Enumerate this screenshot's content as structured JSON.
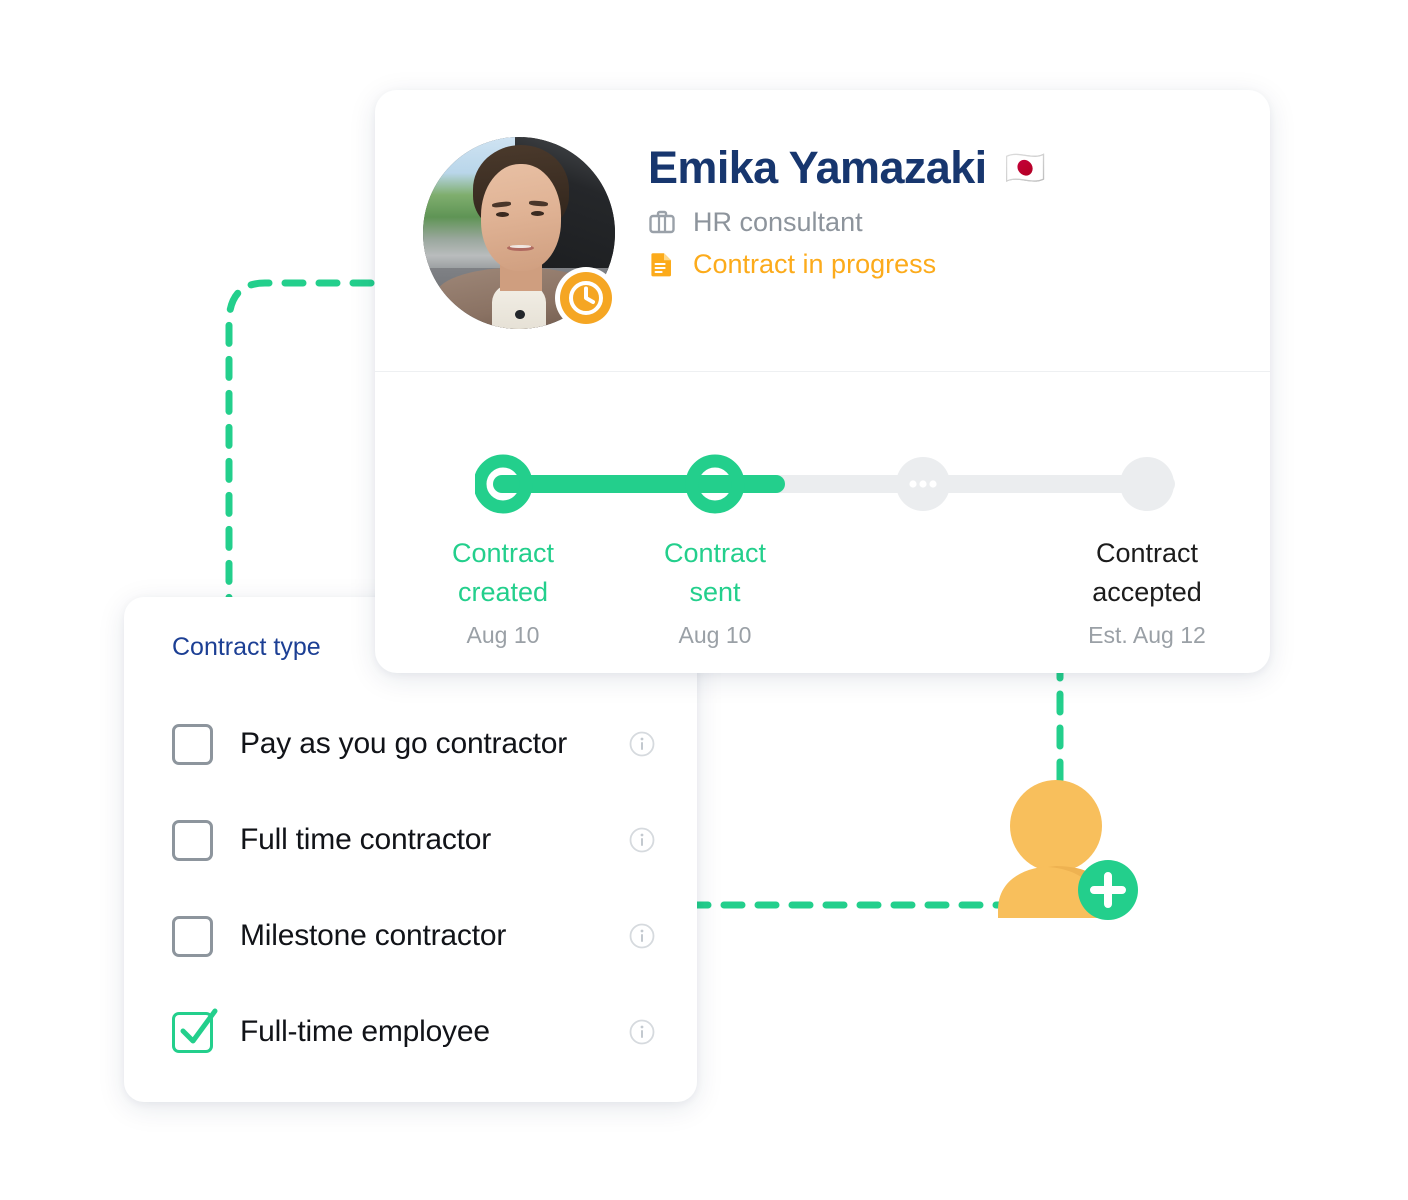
{
  "profile": {
    "name": "Emika Yamazaki",
    "flag": "🇯🇵",
    "flag_icon_name": "japan-flag-icon",
    "role": "HR consultant",
    "role_icon": "briefcase-icon",
    "status": "Contract in progress",
    "status_icon": "document-icon",
    "avatar_badge_icon": "clock-icon",
    "colors": {
      "name": "#17366e",
      "role": "#8d949c",
      "status": "#fcab1b",
      "badge": "#f5a623"
    }
  },
  "timeline": {
    "steps": [
      {
        "title": "Contract\ncreated",
        "date": "Aug 10",
        "state": "done"
      },
      {
        "title": "Contract\nsent",
        "date": "Aug 10",
        "state": "done"
      },
      {
        "title": "",
        "date": "",
        "state": "pending-ellipsis"
      },
      {
        "title": "Contract\naccepted",
        "date": "Est. Aug 12",
        "state": "pending"
      }
    ],
    "colors": {
      "done": "#23cf8c",
      "track": "#ebedef",
      "pending_text": "#1c1c1c",
      "date_text": "#9aa0a6"
    }
  },
  "contract_type": {
    "label": "Contract type",
    "label_color": "#1c3f94",
    "options": [
      {
        "label": "Pay as you go contractor",
        "checked": false,
        "info_icon": "info-icon"
      },
      {
        "label": "Full time contractor",
        "checked": false,
        "info_icon": "info-icon"
      },
      {
        "label": "Milestone contractor",
        "checked": false,
        "info_icon": "info-icon"
      },
      {
        "label": "Full-time employee",
        "checked": true,
        "info_icon": "info-icon"
      }
    ],
    "checked_color": "#23cf8c",
    "unchecked_color": "#8d959d"
  },
  "add_user": {
    "icon_name": "add-user-icon",
    "person_color": "#f8bf5c",
    "plus_badge_color": "#23cf8c"
  },
  "connectors": {
    "color": "#23cf8c",
    "left_name": "connector-card-to-contract-panel",
    "down_name": "connector-card-to-add-user",
    "right_name": "connector-contract-panel-to-add-user"
  }
}
